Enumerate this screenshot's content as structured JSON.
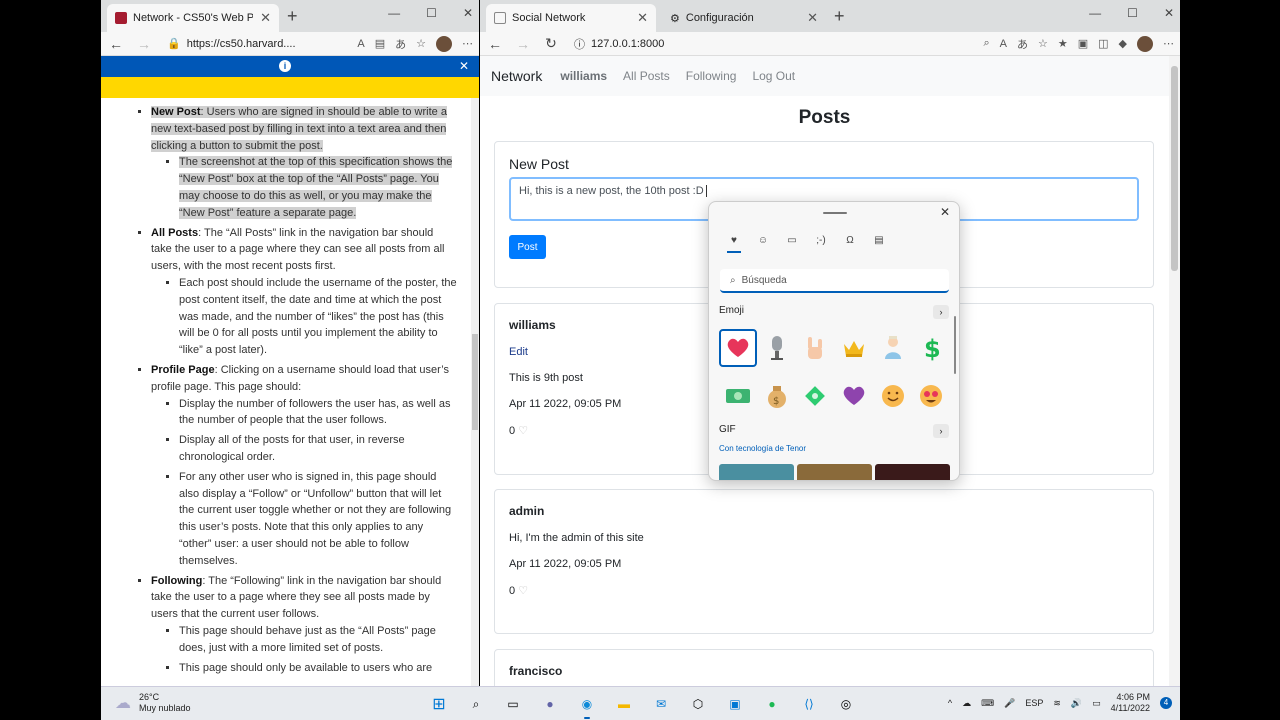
{
  "left_window": {
    "tab_title": "Network - CS50's Web Programming",
    "address": "https://cs50.harvard....",
    "spec": {
      "new_post_title": "New Post",
      "new_post_text": ": Users who are signed in should be able to write a new text-based post by filling in text into a text area and then clicking a button to submit the post.",
      "new_post_sub1": "The screenshot at the top of this specification shows the “New Post” box at the top of the “All Posts” page. You may choose to do this as well, or you may make the “New Post” feature a separate page.",
      "all_posts_title": "All Posts",
      "all_posts_text": ": The “All Posts” link in the navigation bar should take the user to a page where they can see all posts from all users, with the most recent posts first.",
      "all_posts_sub1": "Each post should include the username of the poster, the post content itself, the date and time at which the post was made, and the number of “likes” the post has (this will be 0 for all posts until you implement the ability to “like” a post later).",
      "profile_title": "Profile Page",
      "profile_text": ": Clicking on a username should load that user’s profile page. This page should:",
      "profile_sub1": "Display the number of followers the user has, as well as the number of people that the user follows.",
      "profile_sub2": "Display all of the posts for that user, in reverse chronological order.",
      "profile_sub3": "For any other user who is signed in, this page should also display a “Follow” or “Unfollow” button that will let the current user toggle whether or not they are following this user’s posts. Note that this only applies to any “other” user: a user should not be able to follow themselves.",
      "following_title": "Following",
      "following_text": ": The “Following” link in the navigation bar should take the user to a page where they see all posts made by users that the current user follows.",
      "following_sub1": "This page should behave just as the “All Posts” page does, just with a more limited set of posts.",
      "following_sub2": "This page should only be available to users who are"
    }
  },
  "right_window": {
    "tabs": [
      "Social Network",
      "Configuración"
    ],
    "address": "127.0.0.1:8000",
    "navbar": {
      "brand": "Network",
      "user": "williams",
      "links": [
        "All Posts",
        "Following",
        "Log Out"
      ]
    },
    "page_title": "Posts",
    "new_post": {
      "heading": "New Post",
      "textarea_value": "Hi, this is a new post, the 10th post :D",
      "button": "Post"
    },
    "posts": [
      {
        "username": "williams",
        "edit": "Edit",
        "content": "This is 9th post",
        "date": "Apr 11 2022, 09:05 PM",
        "likes": "0"
      },
      {
        "username": "admin",
        "content": "Hi, I'm the admin of this site",
        "date": "Apr 11 2022, 09:05 PM",
        "likes": "0"
      },
      {
        "username": "francisco"
      }
    ]
  },
  "emoji_picker": {
    "search_placeholder": "Búsqueda",
    "emoji_section": "Emoji",
    "gif_section": "GIF",
    "tenor": "Con tecnología de Tenor",
    "emojis_row1": [
      "❤",
      "🎙",
      "🤟",
      "👑",
      "🧞",
      "💲"
    ],
    "emojis_row2": [
      "💵",
      "💰",
      "💸",
      "💜",
      "🥰",
      "😍"
    ]
  },
  "taskbar": {
    "temperature": "26°C",
    "weather": "Muy nublado",
    "lang": "ESP",
    "time": "4:06 PM",
    "date": "4/11/2022",
    "notifications": "4"
  }
}
